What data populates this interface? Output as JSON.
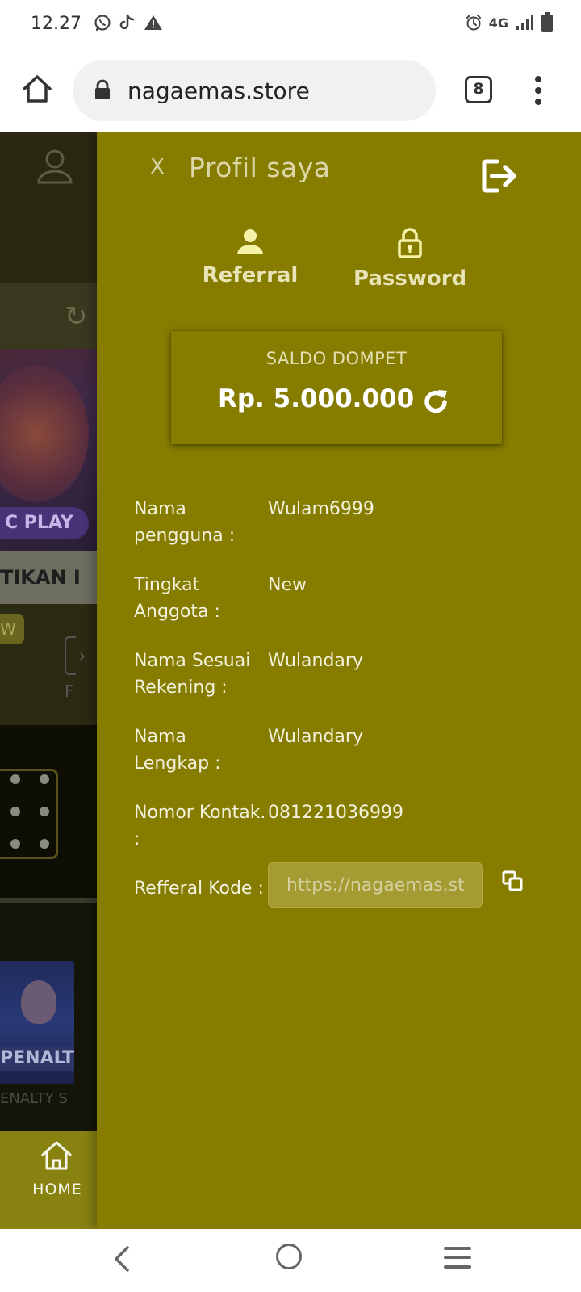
{
  "status_bar": {
    "time": "12.27",
    "network": "4G"
  },
  "browser": {
    "url": "nagaemas.store",
    "tab_count": "8"
  },
  "background_page": {
    "strip_text": "TIKAN I",
    "play_label": "C PLAY",
    "badge_text": "W",
    "f_text": "F",
    "penalty_banner": "PENALT",
    "penalty_caption": "ENALTY S",
    "home_label": "HOME"
  },
  "panel": {
    "close_label": "X",
    "title": "Profil saya",
    "tabs": [
      {
        "label": "Referral",
        "icon": "user-icon"
      },
      {
        "label": "Password",
        "icon": "lock-icon"
      }
    ],
    "wallet": {
      "label": "SALDO DOMPET",
      "amount": "Rp. 5.000.000"
    },
    "info": [
      {
        "label": "Nama pengguna :",
        "value": "Wulam6999"
      },
      {
        "label": "Tingkat Anggota :",
        "value": "New"
      },
      {
        "label": "Nama Sesuai Rekening :",
        "value": "Wulandary"
      },
      {
        "label": "Nama Lengkap :",
        "value": "Wulandary"
      },
      {
        "label": "Nomor Kontak. :",
        "value": "081221036999"
      }
    ],
    "referral": {
      "label": "Refferal Kode :",
      "value": "https://nagaemas.store"
    }
  },
  "colors": {
    "panel_bg": "#857c00",
    "home_bar": "#888311",
    "input_bg": "#a49b32"
  }
}
